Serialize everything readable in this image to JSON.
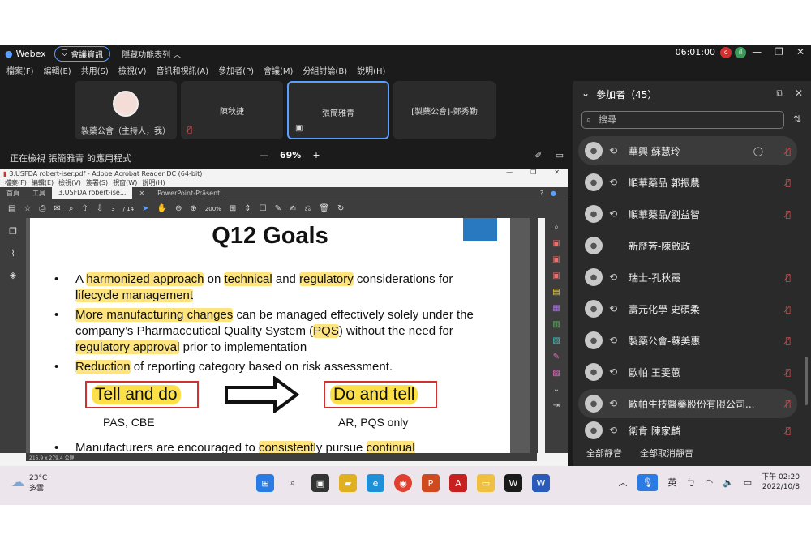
{
  "app": {
    "name": "Webex",
    "meeting_info": "會議資訊",
    "hidden_menu": "隱藏功能表列",
    "time": "06:01:00"
  },
  "menu": [
    "檔案(F)",
    "編輯(E)",
    "共用(S)",
    "檢視(V)",
    "音訊和視訊(A)",
    "參加者(P)",
    "會議(M)",
    "分組討論(B)",
    "說明(H)"
  ],
  "tiles": [
    {
      "name": "製藥公會（主持人，我）"
    },
    {
      "name": "陳秋捷"
    },
    {
      "name": "張簡雅青"
    },
    {
      "name": "[製藥公會]-鄭秀勤"
    }
  ],
  "viewing": "正在檢視 張簡雅青 的應用程式",
  "zoom": "69%",
  "acrobat": {
    "title": "3.USFDA robert-iser.pdf - Adobe Acrobat Reader DC (64-bit)",
    "menu": [
      "檔案(F)",
      "編輯(E)",
      "檢視(V)",
      "簽署(S)",
      "視窗(W)",
      "說明(H)"
    ],
    "tabs": [
      "首頁",
      "工具",
      "3.USFDA robert-ise...",
      "PowerPoint-Präsent..."
    ],
    "page": "3",
    "pages": "/ 14",
    "zoom": "200%",
    "size": "215.9 x 279.4 公厘"
  },
  "slide": {
    "title": "Q12 Goals",
    "b1_pre": "A ",
    "b1_h1": "harmonized approach",
    "b1_m1": " on ",
    "b1_h2": "technical",
    "b1_m2": " and ",
    "b1_h3": "regulatory",
    "b1_m3": " considerations for",
    "b1_h4": "lifecycle management",
    "b2_h1": "More manufacturing changes",
    "b2_m1": " can be managed effectively solely under the company’s Pharmaceutical Quality System (",
    "b2_h2": "PQS",
    "b2_m2": ") without the need for ",
    "b2_h3": "regulatory approval",
    "b2_m3": " prior to implementation",
    "b3_h1": "Reduction",
    "b3_m1": " of reporting category based on risk assessment.",
    "box_left": "Tell and do",
    "box_right": "Do and tell",
    "under_left": "PAS, CBE",
    "under_right": "AR, PQS only",
    "b4_m1": "Manufacturers are encouraged to ",
    "b4_h1": "consistent",
    "b4_m2": "ly pursue ",
    "b4_h2": "continual"
  },
  "participants": {
    "header": "參加者（45）",
    "search_placeholder": "搜尋",
    "list": [
      {
        "name": "華興 蘇慧玲"
      },
      {
        "name": "順華藥品 郭振農"
      },
      {
        "name": "順華藥品/劉益智"
      },
      {
        "name": "新歷芳-陳啟政"
      },
      {
        "name": "瑞士-孔秋霞"
      },
      {
        "name": "壽元化學 史碩柔"
      },
      {
        "name": "製藥公會-蘇美惠"
      },
      {
        "name": "歐帕 王雯蕙"
      },
      {
        "name": "歐帕生技醫藥股份有限公司..."
      },
      {
        "name": "衛肯 陳家麟"
      }
    ],
    "mute_all": "全部靜音",
    "unmute_all": "全部取消靜音"
  },
  "taskbar": {
    "temp": "23°C",
    "weather": "多雲",
    "lang": "英",
    "ime": "ㄅ",
    "time": "下午 02:20",
    "date": "2022/10/8"
  }
}
